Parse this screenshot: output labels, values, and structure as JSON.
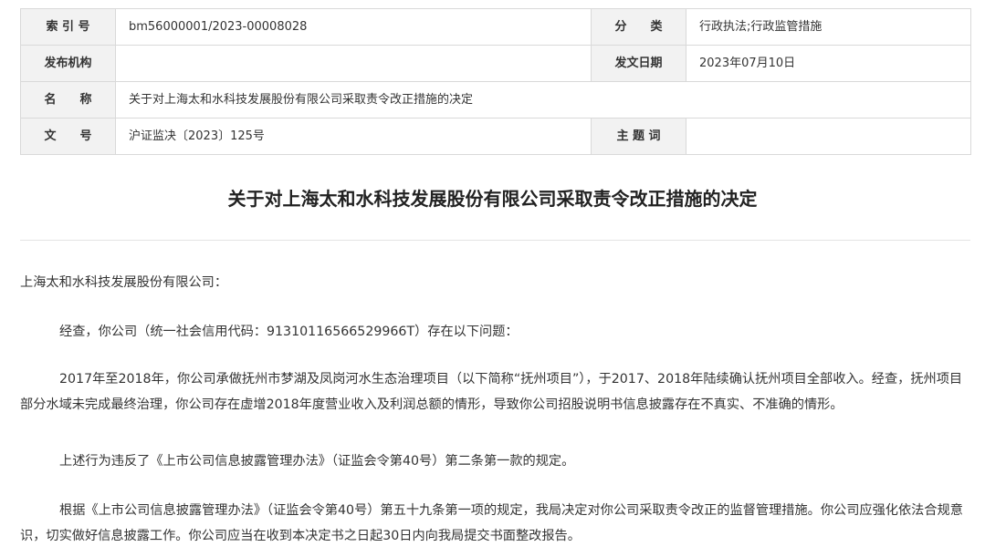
{
  "meta": {
    "index_label": "索 引 号",
    "index_value": "bm56000001/2023-00008028",
    "category_label": "分　　类",
    "category_value": "行政执法;行政监管措施",
    "issuer_label": "发布机构",
    "issuer_value": "",
    "date_label": "发文日期",
    "date_value": "2023年07月10日",
    "name_label": "名　　称",
    "name_value": "关于对上海太和水科技发展股份有限公司采取责令改正措施的决定",
    "docno_label": "文　　号",
    "docno_value": "沪证监决〔2023〕125号",
    "subject_label": "主 题 词",
    "subject_value": ""
  },
  "document": {
    "title": "关于对上海太和水科技发展股份有限公司采取责令改正措施的决定",
    "salutation": "上海太和水科技发展股份有限公司：",
    "paragraphs": [
      "经查，你公司（统一社会信用代码：91310116566529966T）存在以下问题：",
      "2017年至2018年，你公司承做抚州市梦湖及凤岗河水生态治理项目（以下简称“抚州项目”），于2017、2018年陆续确认抚州项目全部收入。经查，抚州项目部分水域未完成最终治理，你公司存在虚增2018年度营业收入及利润总额的情形，导致你公司招股说明书信息披露存在不真实、不准确的情形。",
      "上述行为违反了《上市公司信息披露管理办法》（证监会令第40号）第二条第一款的规定。",
      "根据《上市公司信息披露管理办法》（证监会令第40号）第五十九条第一项的规定，我局决定对你公司采取责令改正的监督管理措施。你公司应强化依法合规意识，切实做好信息披露工作。你公司应当在收到本决定书之日起30日内向我局提交书面整改报告。"
    ]
  }
}
